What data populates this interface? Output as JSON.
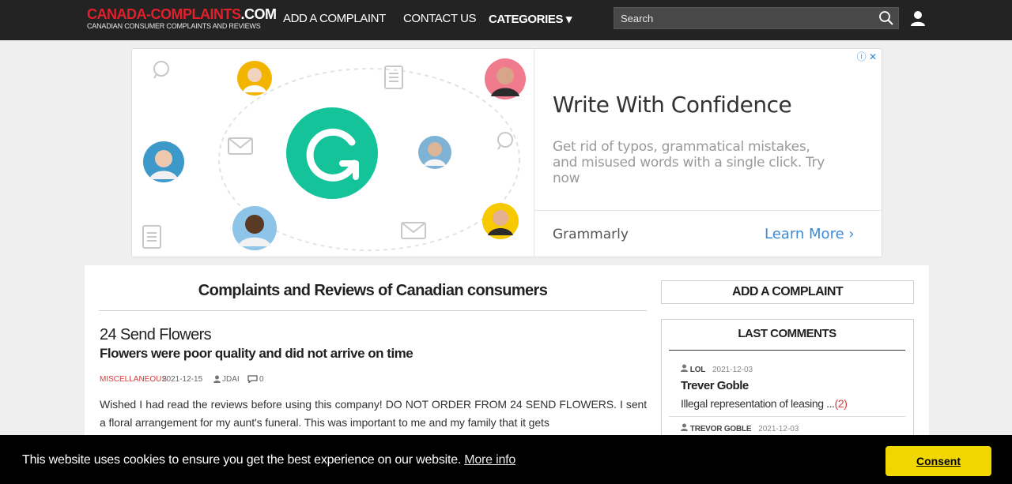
{
  "header": {
    "logo_red": "CANADA-COMPLAINTS",
    "logo_white": ".COM",
    "logo_tagline": "CANADIAN CONSUMER COMPLAINTS AND REVIEWS",
    "nav": {
      "add_complaint": "ADD A COMPLAINT",
      "contact_us": "CONTACT US",
      "categories": "CATEGORIES ▾"
    },
    "search_placeholder": "Search",
    "icons": [
      "search-icon",
      "user-icon"
    ]
  },
  "ad": {
    "headline": "Write With Confidence",
    "body": "Get rid of typos, grammatical mistakes, and misused words with a single click. Try now",
    "brand": "Grammarly",
    "cta": "Learn More ›",
    "choices": "ⓘ ✕",
    "brand_color": "#15c39a"
  },
  "main": {
    "title": "Complaints and Reviews of Canadian consumers",
    "post": {
      "company": "24 Send Flowers",
      "title": "Flowers were poor quality and did not arrive on time",
      "category": "MISCELLANEOUS",
      "date": "2021-12-15",
      "author": "JDAI",
      "comments": "0",
      "body": "Wished I had read the reviews before using this company! DO NOT ORDER FROM 24 SEND FLOWERS. I sent a floral arrangement for my aunt's funeral. This was important to me and my family that it gets"
    }
  },
  "sidebar": {
    "add_button": "ADD A COMPLAINT",
    "last_comments_heading": "LAST COMMENTS",
    "comments": [
      {
        "user": "LOL",
        "date": "2021-12-03",
        "title": "Trever Goble",
        "text": "Illegal representation of leasing ...",
        "count": "(2)"
      },
      {
        "user": "TREVOR GOBLE",
        "date": "2021-12-03"
      }
    ]
  },
  "cookie": {
    "text": "This website uses cookies to ensure you get the best experience on our website.",
    "more_info": "More info",
    "consent": "Consent",
    "button_color": "#f1d600"
  },
  "colors": {
    "topbar": "#232323",
    "accent_red": "#e0202a",
    "link_blue": "#3b8ad6"
  }
}
